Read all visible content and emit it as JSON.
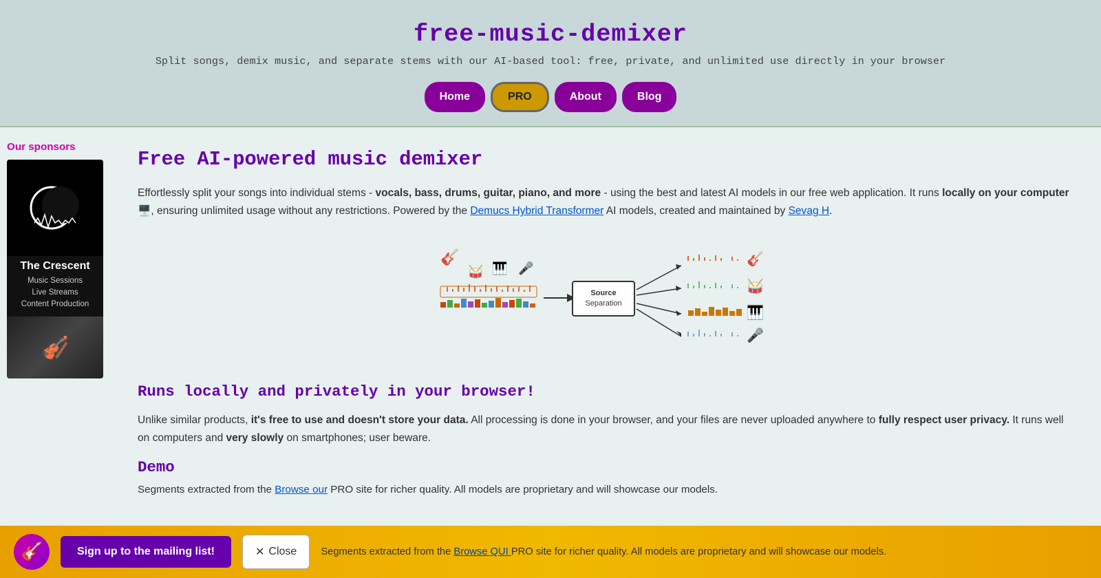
{
  "header": {
    "title": "free-music-demixer",
    "subtitle": "Split songs, demix music, and separate stems with our AI-based tool: free, private, and unlimited use directly in your browser",
    "nav": [
      {
        "label": "Home",
        "key": "home"
      },
      {
        "label": "PRO",
        "key": "pro"
      },
      {
        "label": "About",
        "key": "about"
      },
      {
        "label": "Blog",
        "key": "blog"
      }
    ]
  },
  "sidebar": {
    "sponsors_label": "Our sponsors",
    "sponsor": {
      "name": "The Crescent",
      "details_line1": "Music Sessions",
      "details_line2": "Live Streams",
      "details_line3": "Content Production"
    }
  },
  "main": {
    "heading": "Free AI-powered music demixer",
    "intro_text": "Effortlessly split your songs into individual stems - ",
    "intro_bold": "vocals, bass, drums, guitar, piano, and more",
    "intro_text2": " - using the best and latest AI models in our free web application. It runs ",
    "intro_bold2": "locally on your computer 🖥️",
    "intro_text3": ", ensuring unlimited usage without any restrictions. Powered by the ",
    "link1": "Demucs Hybrid Transformer",
    "intro_text4": " AI models, created and maintained by ",
    "link2": "Sevag H",
    "intro_text5": ".",
    "subheading": "Runs locally and privately in your browser!",
    "para2_text1": "Unlike similar products, ",
    "para2_bold1": "it's free to use and doesn't store your data.",
    "para2_text2": " All processing is done in your browser, and your files are never uploaded anywhere to ",
    "para2_bold2": "fully respect user privacy.",
    "para2_text3": " It runs well on computers and ",
    "para2_bold3": "very slowly",
    "para2_text4": " on smartphones; user beware.",
    "demo_heading": "Demo",
    "demo_text1": "Segments extracted from the",
    "demo_link": "Browse our",
    "demo_text2": " PRO site for richer quality. All models are proprietary and will showcase our models. "
  },
  "diagram": {
    "sep_box_title": "Source",
    "sep_box_sub": "Separation",
    "inputs": [
      "🎸",
      "🥁",
      "🎹",
      "🎤"
    ],
    "outputs": [
      "🎸",
      "🥁",
      "🎹",
      "🎤"
    ]
  },
  "bottom_bar": {
    "icon": "🎸",
    "cta_label": "Sign up to the mailing list!",
    "close_label": "Close",
    "close_x": "✕",
    "browse_qui": "Browse QUI"
  }
}
